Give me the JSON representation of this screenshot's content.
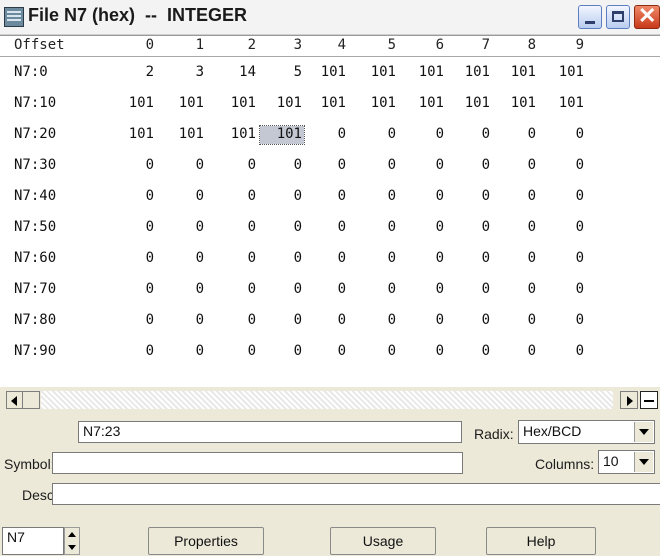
{
  "window": {
    "title": "File N7 (hex)  --  INTEGER",
    "controls": {
      "minimize": "minimize",
      "maximize": "maximize",
      "close": "close"
    }
  },
  "table": {
    "header_label": "Offset",
    "columns": [
      "0",
      "1",
      "2",
      "3",
      "4",
      "5",
      "6",
      "7",
      "8",
      "9"
    ],
    "rows": [
      {
        "label": "N7:0",
        "values": [
          "2",
          "3",
          "14",
          "5",
          "101",
          "101",
          "101",
          "101",
          "101",
          "101"
        ]
      },
      {
        "label": "N7:10",
        "values": [
          "101",
          "101",
          "101",
          "101",
          "101",
          "101",
          "101",
          "101",
          "101",
          "101"
        ]
      },
      {
        "label": "N7:20",
        "values": [
          "101",
          "101",
          "101",
          "101",
          "0",
          "0",
          "0",
          "0",
          "0",
          "0"
        ]
      },
      {
        "label": "N7:30",
        "values": [
          "0",
          "0",
          "0",
          "0",
          "0",
          "0",
          "0",
          "0",
          "0",
          "0"
        ]
      },
      {
        "label": "N7:40",
        "values": [
          "0",
          "0",
          "0",
          "0",
          "0",
          "0",
          "0",
          "0",
          "0",
          "0"
        ]
      },
      {
        "label": "N7:50",
        "values": [
          "0",
          "0",
          "0",
          "0",
          "0",
          "0",
          "0",
          "0",
          "0",
          "0"
        ]
      },
      {
        "label": "N7:60",
        "values": [
          "0",
          "0",
          "0",
          "0",
          "0",
          "0",
          "0",
          "0",
          "0",
          "0"
        ]
      },
      {
        "label": "N7:70",
        "values": [
          "0",
          "0",
          "0",
          "0",
          "0",
          "0",
          "0",
          "0",
          "0",
          "0"
        ]
      },
      {
        "label": "N7:80",
        "values": [
          "0",
          "0",
          "0",
          "0",
          "0",
          "0",
          "0",
          "0",
          "0",
          "0"
        ]
      },
      {
        "label": "N7:90",
        "values": [
          "0",
          "0",
          "0",
          "0",
          "0",
          "0",
          "0",
          "0",
          "0",
          "0"
        ]
      }
    ],
    "selected": {
      "row": 2,
      "col": 3
    }
  },
  "panel": {
    "address_value": "N7:23",
    "symbol_label": "Symbol:",
    "symbol_value": "",
    "desc_label": "Desc:",
    "desc_value": "",
    "radix_label": "Radix:",
    "radix_value": "Hex/BCD",
    "columns_label": "Columns:",
    "columns_value": "10",
    "file_value": "N7",
    "properties_button": "Properties",
    "usage_button": "Usage",
    "help_button": "Help"
  },
  "colors": {
    "selection": "#c4c8d2",
    "background": "#ece9d8"
  }
}
